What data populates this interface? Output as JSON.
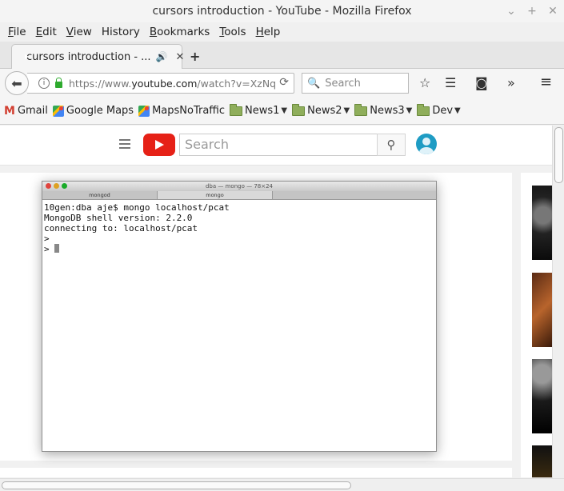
{
  "window": {
    "title": "cursors introduction - YouTube - Mozilla Firefox",
    "controls": [
      "minimize",
      "maximize",
      "close"
    ]
  },
  "menu": [
    {
      "accel": "F",
      "rest": "ile"
    },
    {
      "accel": "E",
      "rest": "dit"
    },
    {
      "accel": "V",
      "rest": "iew"
    },
    {
      "accel": "Hi",
      "rest": "story",
      "accel_index": 2
    },
    {
      "accel": "B",
      "rest": "ookmarks"
    },
    {
      "accel": "T",
      "rest": "ools"
    },
    {
      "accel": "H",
      "rest": "elp"
    }
  ],
  "menu_labels": [
    "File",
    "Edit",
    "View",
    "History",
    "Bookmarks",
    "Tools",
    "Help"
  ],
  "tab": {
    "title": "cursors introduction - ...",
    "icons": {
      "favicon": "youtube-icon",
      "audio": "speaker-icon",
      "close": "close-icon"
    }
  },
  "new_tab_label": "+",
  "navbar": {
    "url_prefix": "https://www.",
    "url_domain": "youtube.com",
    "url_rest": "/watch?v=XzNq",
    "search_placeholder": "Search"
  },
  "bookmarks": [
    {
      "label": "Gmail",
      "icon": "gmail-icon"
    },
    {
      "label": "Google Maps",
      "icon": "maps-icon"
    },
    {
      "label": "MapsNoTraffic",
      "icon": "maps-icon"
    },
    {
      "label": "News1",
      "icon": "folder-icon",
      "dropdown": true
    },
    {
      "label": "News2",
      "icon": "folder-icon",
      "dropdown": true
    },
    {
      "label": "News3",
      "icon": "folder-icon",
      "dropdown": true
    },
    {
      "label": "Dev",
      "icon": "folder-icon",
      "dropdown": true
    }
  ],
  "youtube": {
    "search_placeholder": "Search"
  },
  "terminal": {
    "title": "dba — mongo — 78×24",
    "tabs": [
      "mongod",
      "mongo"
    ],
    "lines": [
      "10gen:dba aje$ mongo localhost/pcat",
      "MongoDB shell version: 2.2.0",
      "connecting to: localhost/pcat",
      ">",
      "> "
    ]
  },
  "colors": {
    "youtube_red": "#e62117",
    "avatar_blue": "#1e9cc4",
    "lock_green": "#2eaa2e"
  }
}
